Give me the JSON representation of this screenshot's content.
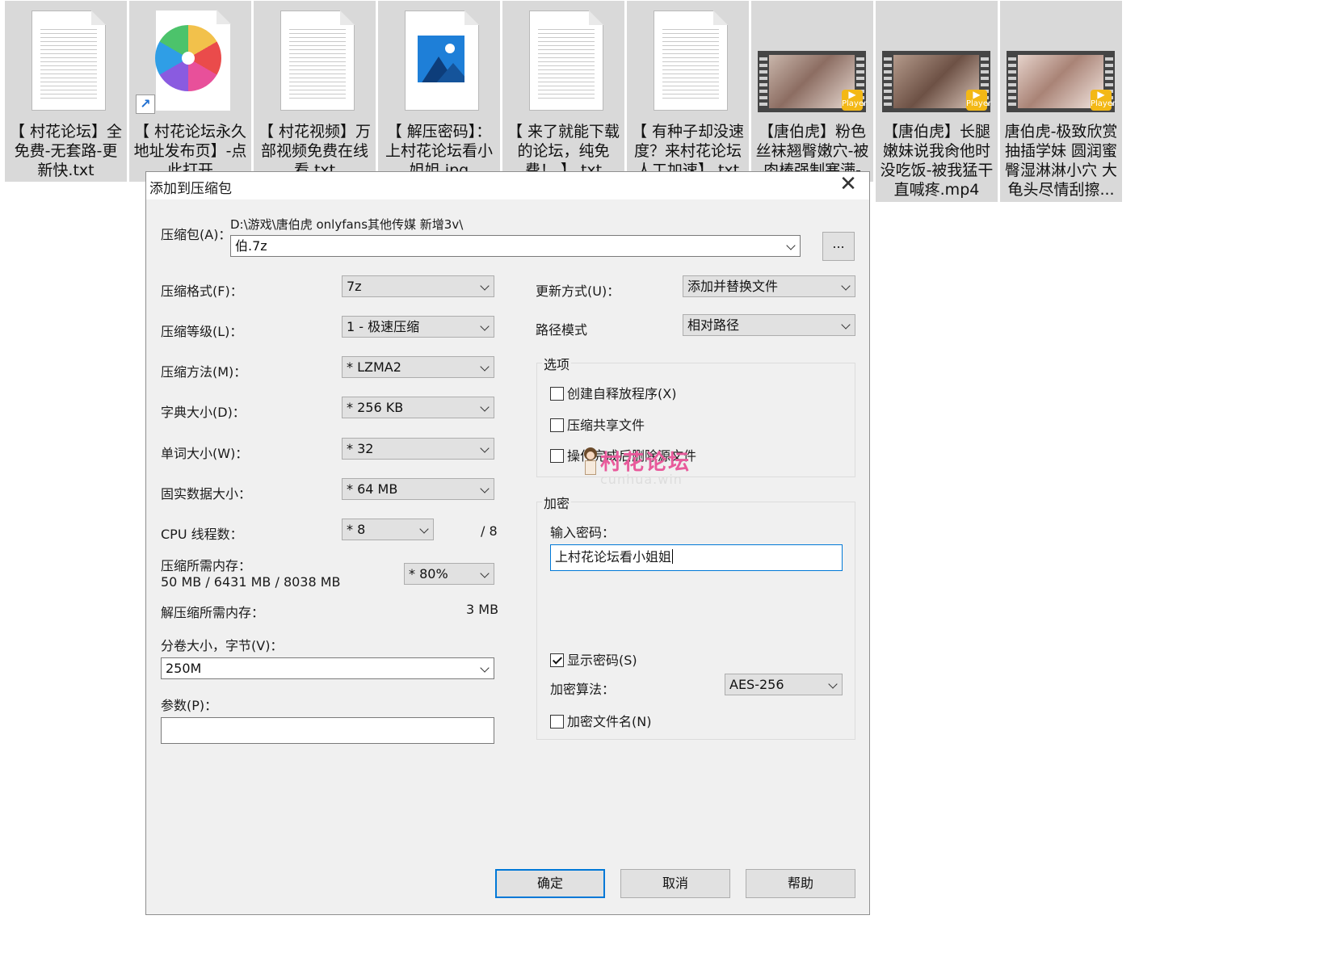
{
  "files": [
    {
      "name": "【 村花论坛】全\n免费-无套路-更\n新快.txt",
      "type": "txt"
    },
    {
      "name": "【 村花论坛永久\n地址发布页】-点\n此打开",
      "type": "shortcut"
    },
    {
      "name": "【 村花视频】万\n部视频免费在线\n看.txt",
      "type": "txt"
    },
    {
      "name": "【 解压密码】：\n上村花论坛看小\n姐姐.jpg",
      "type": "jpg"
    },
    {
      "name": "【 来了就能下载\n的论坛，纯免\n费！ 】.txt",
      "type": "txt"
    },
    {
      "name": "【 有种子却没速\n度？来村花论坛\n人工加速】.txt",
      "type": "txt"
    },
    {
      "name": "【唐伯虎】粉色\n丝袜翘臀嫩穴-被\n肉棒强制塞满-",
      "type": "video"
    },
    {
      "name": "【唐伯虎】长腿\n嫩妹说我肏他时\n没吃饭-被我猛干\n直喊疼.mp4",
      "type": "video"
    },
    {
      "name": "唐伯虎-极致欣赏\n抽插学妹 圆润蜜\n臀湿淋淋小穴 大\n龟头尽情刮擦...",
      "type": "video"
    }
  ],
  "video_badge": "Player",
  "dialog": {
    "title": "添加到压缩包",
    "close_icon": "✕",
    "archive_label": "压缩包(A)：",
    "archive_path": "D:\\游戏\\唐伯虎 onlyfans其他传媒 新增3v\\",
    "archive_name": "伯.7z",
    "browse_label": "...",
    "format_label": "压缩格式(F)：",
    "format_value": "7z",
    "level_label": "压缩等级(L)：",
    "level_value": "1 - 极速压缩",
    "method_label": "压缩方法(M)：",
    "method_value": "*  LZMA2",
    "dict_label": "字典大小(D)：",
    "dict_value": "*  256 KB",
    "word_label": "单词大小(W)：",
    "word_value": "*  32",
    "solid_label": "固实数据大小：",
    "solid_value": "*  64 MB",
    "cpu_label": "CPU 线程数：",
    "cpu_value": "*  8",
    "cpu_total": "/ 8",
    "mem_label": "压缩所需内存：",
    "mem_value": "50 MB / 6431 MB / 8038 MB",
    "mem_percent": "* 80%",
    "decomp_label": "解压缩所需内存：",
    "decomp_value": "3 MB",
    "volume_label": "分卷大小，字节(V)：",
    "volume_value": "250M",
    "params_label": "参数(P)：",
    "params_value": "",
    "update_label": "更新方式(U)：",
    "update_value": "添加并替换文件",
    "pathmode_label": "路径模式",
    "pathmode_value": "相对路径",
    "options_title": "选项",
    "opt_sfx": "创建自释放程序(X)",
    "opt_shared": "压缩共享文件",
    "opt_delete": "操作完成后删除源文件",
    "encrypt_title": "加密",
    "password_label": "输入密码：",
    "password_value": "上村花论坛看小姐姐",
    "show_password": "显示密码(S)",
    "algo_label": "加密算法：",
    "algo_value": "AES-256",
    "encrypt_names": "加密文件名(N)",
    "ok": "确定",
    "cancel": "取消",
    "help": "帮助"
  },
  "watermark": {
    "text": "村花论坛",
    "sub": "cunhua.win"
  }
}
